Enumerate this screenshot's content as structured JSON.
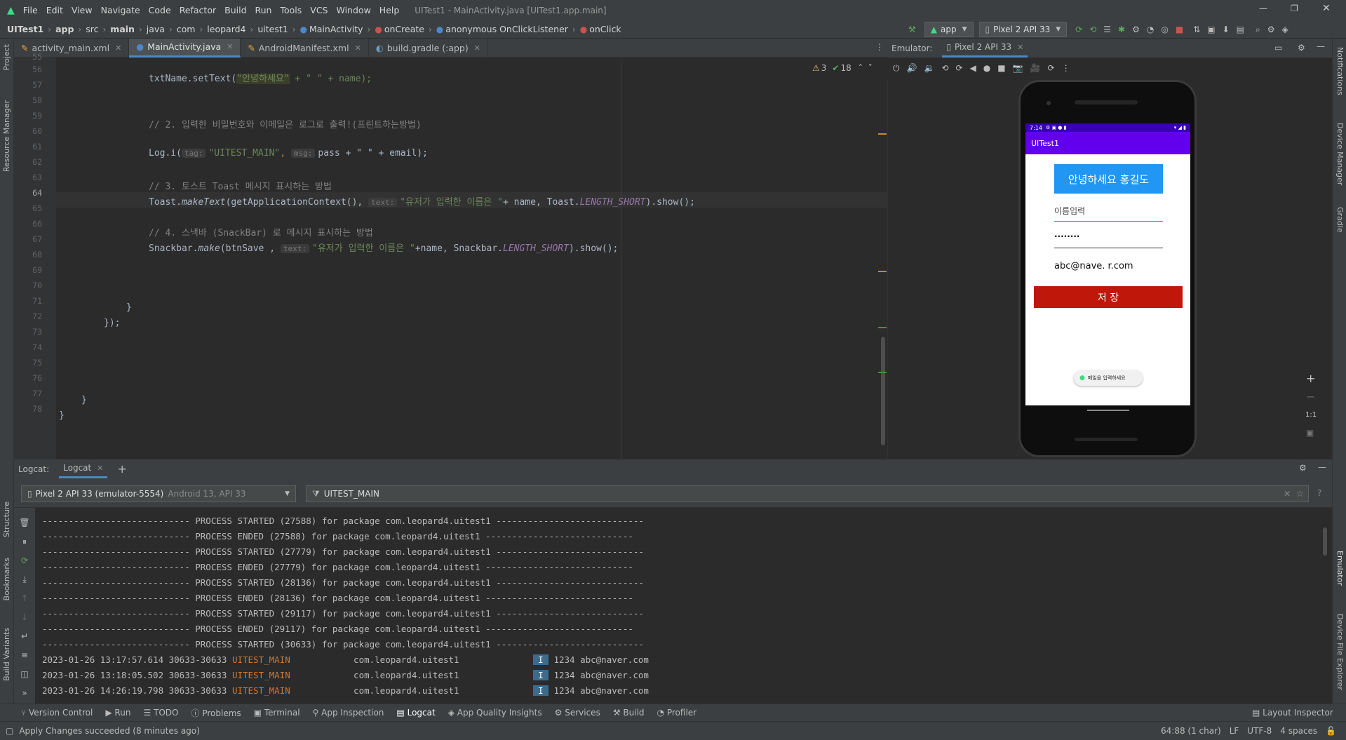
{
  "title": {
    "menu": [
      "File",
      "Edit",
      "View",
      "Navigate",
      "Code",
      "Refactor",
      "Build",
      "Run",
      "Tools",
      "VCS",
      "Window",
      "Help"
    ],
    "window_title": "UITest1 - MainActivity.java [UITest1.app.main]"
  },
  "breadcrumb": [
    "UITest1",
    "app",
    "src",
    "main",
    "java",
    "com",
    "leopard4",
    "uitest1",
    "MainActivity",
    "onCreate",
    "anonymous OnClickListener",
    "onClick"
  ],
  "toolbar": {
    "run_config": "app",
    "device": "Pixel 2 API 33"
  },
  "tabs": [
    "activity_main.xml",
    "MainActivity.java",
    "AndroidManifest.xml",
    "build.gradle (:app)"
  ],
  "inspection": {
    "warnings": "3",
    "weak": "18"
  },
  "left_strip": [
    "Project",
    "Resource Manager",
    "Structure",
    "Bookmarks",
    "Build Variants"
  ],
  "right_strip": [
    "Notifications",
    "Device Manager",
    "Gradle",
    "Emulator",
    "Device File Explorer"
  ],
  "code": {
    "line_numbers": [
      "55",
      "56",
      "57",
      "58",
      "59",
      "60",
      "61",
      "62",
      "63",
      "64",
      "65",
      "66",
      "67",
      "68",
      "69",
      "70",
      "71",
      "72",
      "73",
      "74",
      "75",
      "76",
      "77",
      "78"
    ],
    "l56_a": "txtName.setText(",
    "l56_b": "\"안녕하세요\"",
    "l56_c": " + \" \" + name);",
    "l59": "// 2. 입력한 비밀번호와 이메일은 로그로 출력!(프린트하는방법)",
    "l61_a": "Log.i(",
    "l61_hint1": "tag:",
    "l61_b": "\"UITEST_MAIN\"",
    "l61_c": ",",
    "l61_hint2": "msg:",
    "l61_d": "pass + \" \" + email);",
    "l63": "// 3. 토스트 Toast 메시지 표시하는 방법",
    "l64_a": "Toast.",
    "l64_b": "makeText",
    "l64_c": "(getApplicationContext(),",
    "l64_hint": "text:",
    "l64_d": "\"유저가 입력한 이름은 \"",
    "l64_e": "+ name, Toast.",
    "l64_f": "LENGTH_SHORT",
    "l64_g": ").show();",
    "l66": "// 4. 스낵바 (SnackBar) 로 메시지 표시하는 방법",
    "l67_a": "Snackbar.",
    "l67_b": "make",
    "l67_c": "(btnSave ,",
    "l67_hint": "text:",
    "l67_d": "\"유저가 입력한 이름은 \"",
    "l67_e": "+name, Snackbar.",
    "l67_f": "LENGTH_SHORT",
    "l67_g": ").show();",
    "l71": "}",
    "l72": "});",
    "l77": "}",
    "l78": "}"
  },
  "emulator": {
    "label": "Emulator:",
    "tab": "Pixel 2 API 33",
    "status_time": "7:14",
    "app_title": "UITest1",
    "greeting": "안녕하세요 홍길도",
    "name_placeholder": "이름입력",
    "password": "········",
    "email": "abc@nave. r.com",
    "save_button": "저  장",
    "snackbar": "메일을 입력하세요",
    "zoom_label": "1:1"
  },
  "logcat": {
    "label": "Logcat:",
    "tab": "Logcat",
    "device": "Pixel 2 API 33 (emulator-5554)",
    "device_os": "Android 13, API 33",
    "filter": "UITEST_MAIN",
    "lines": [
      "---------------------------- PROCESS STARTED (27588) for package com.leopard4.uitest1 ----------------------------",
      "---------------------------- PROCESS ENDED (27588) for package com.leopard4.uitest1 ----------------------------",
      "---------------------------- PROCESS STARTED (27779) for package com.leopard4.uitest1 ----------------------------",
      "---------------------------- PROCESS ENDED (27779) for package com.leopard4.uitest1 ----------------------------",
      "---------------------------- PROCESS STARTED (28136) for package com.leopard4.uitest1 ----------------------------",
      "---------------------------- PROCESS ENDED (28136) for package com.leopard4.uitest1 ----------------------------",
      "---------------------------- PROCESS STARTED (29117) for package com.leopard4.uitest1 ----------------------------",
      "---------------------------- PROCESS ENDED (29117) for package com.leopard4.uitest1 ----------------------------",
      "---------------------------- PROCESS STARTED (30633) for package com.leopard4.uitest1 ----------------------------"
    ],
    "entries": [
      {
        "time": "2023-01-26 13:17:57.614 30633-30633",
        "tag": "UITEST_MAIN",
        "pkg": "com.leopard4.uitest1",
        "level": "I",
        "msg": "1234 abc@naver.com"
      },
      {
        "time": "2023-01-26 13:18:05.502 30633-30633",
        "tag": "UITEST_MAIN",
        "pkg": "com.leopard4.uitest1",
        "level": "I",
        "msg": "1234 abc@naver.com"
      },
      {
        "time": "2023-01-26 14:26:19.798 30633-30633",
        "tag": "UITEST_MAIN",
        "pkg": "com.leopard4.uitest1",
        "level": "I",
        "msg": "1234 abc@naver.com"
      }
    ]
  },
  "bottom_tools": [
    "Version Control",
    "Run",
    "TODO",
    "Problems",
    "Terminal",
    "App Inspection",
    "Logcat",
    "App Quality Insights",
    "Services",
    "Build",
    "Profiler"
  ],
  "layout_inspector": "Layout Inspector",
  "status": {
    "message": "Apply Changes succeeded (8 minutes ago)",
    "position": "64:88 (1 char)",
    "line_sep": "LF",
    "encoding": "UTF-8",
    "indent": "4 spaces"
  },
  "colors": {
    "accent": "#4a88c7",
    "app_primary": "#6200ee",
    "save_button": "#c0170b",
    "greeting_bg": "#2196f3"
  }
}
